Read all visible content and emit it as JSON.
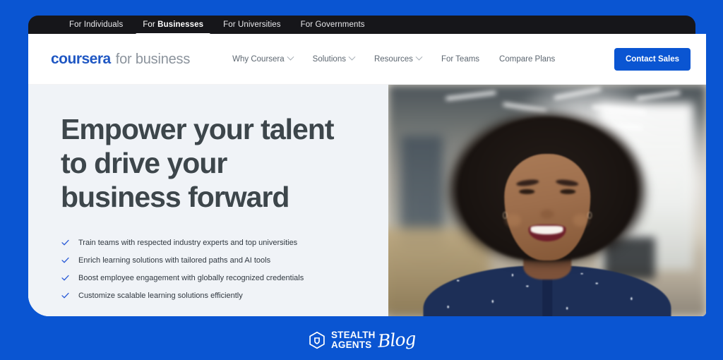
{
  "colors": {
    "page_background": "#0a55d2",
    "tabbar_background": "#16161a",
    "hero_background": "#f0f3f7",
    "brand_blue": "#1f57c3",
    "cta_blue": "#0a55d2",
    "headline_gray": "#3d464b",
    "check_blue": "#2a5bd7"
  },
  "browser_tabs": [
    {
      "prefix": "For ",
      "strong": "Individuals",
      "active": false
    },
    {
      "prefix": "For ",
      "strong": "Businesses",
      "active": true
    },
    {
      "prefix": "For ",
      "strong": "Universities",
      "active": false
    },
    {
      "prefix": "For ",
      "strong": "Governments",
      "active": false
    }
  ],
  "header": {
    "logo": {
      "brand": "coursera",
      "suffix": "for business"
    },
    "nav": [
      {
        "label": "Why Coursera",
        "has_caret": true
      },
      {
        "label": "Solutions",
        "has_caret": true
      },
      {
        "label": "Resources",
        "has_caret": true
      },
      {
        "label": "For Teams",
        "has_caret": false
      },
      {
        "label": "Compare Plans",
        "has_caret": false
      }
    ],
    "cta_label": "Contact Sales"
  },
  "hero": {
    "headline": "Empower your talent to drive your business forward",
    "bullets": [
      "Train teams with respected industry experts and top universities",
      "Enrich learning solutions with tailored paths and AI tools",
      "Boost employee engagement with globally recognized credentials",
      "Customize scalable learning solutions efficiently"
    ],
    "image_alt": "Smiling woman with afro hair wearing a navy polka-dot shirt in a bright blurred office"
  },
  "watermark": {
    "line1": "STEALTH",
    "line2": "AGENTS",
    "script": "Blog"
  }
}
